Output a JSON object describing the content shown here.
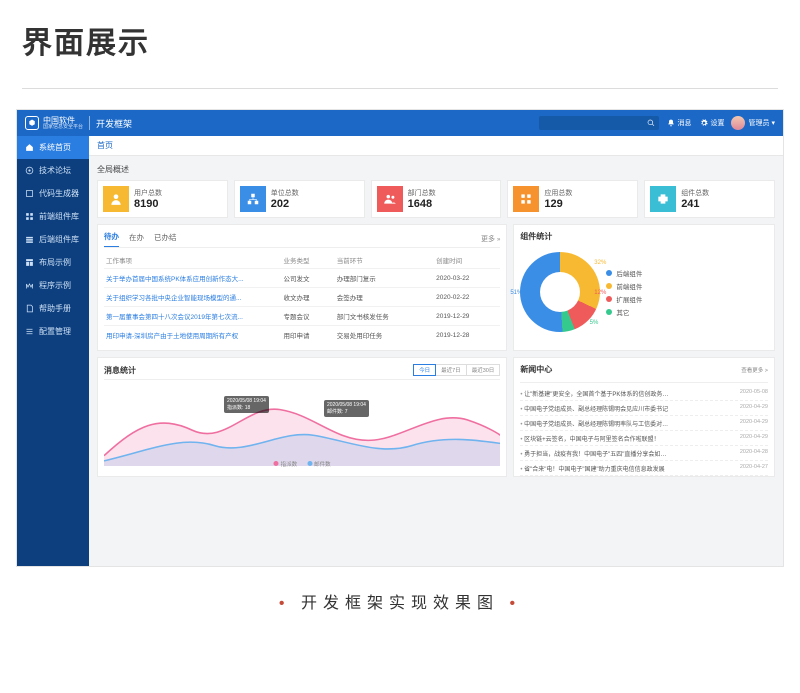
{
  "page": {
    "heading": "界面展示",
    "caption": "开发框架实现效果图"
  },
  "header": {
    "brand": "中国软件",
    "brand_sub": "国家信息安全平台",
    "app": "开发框架",
    "link_msg": "消息",
    "link_set": "设置",
    "role": "管理员"
  },
  "sidebar": {
    "items": [
      {
        "label": "系统首页"
      },
      {
        "label": "技术论坛"
      },
      {
        "label": "代码生成器"
      },
      {
        "label": "前端组件库"
      },
      {
        "label": "后端组件库"
      },
      {
        "label": "布局示例"
      },
      {
        "label": "程序示例"
      },
      {
        "label": "帮助手册"
      },
      {
        "label": "配置管理"
      }
    ]
  },
  "tabbar": {
    "home": "首页"
  },
  "overview": {
    "title": "全局概述",
    "stats": [
      {
        "label": "用户总数",
        "value": "8190"
      },
      {
        "label": "单位总数",
        "value": "202"
      },
      {
        "label": "部门总数",
        "value": "1648"
      },
      {
        "label": "应用总数",
        "value": "129"
      },
      {
        "label": "组件总数",
        "value": "241"
      }
    ]
  },
  "todo": {
    "tabs": [
      "待办",
      "在办",
      "已办结"
    ],
    "more": "更多",
    "cols": [
      "工作事项",
      "业务类型",
      "当前环节",
      "创建时间"
    ],
    "rows": [
      {
        "a": "关于举办首届中国系统PK体系应用创新作态大...",
        "b": "公司发文",
        "c": "办理部门复示",
        "d": "2020-03-22"
      },
      {
        "a": "关于组织学习各批中央企业智能现场模型的通...",
        "b": "收文办理",
        "c": "会签办理",
        "d": "2020-02-22"
      },
      {
        "a": "第一届董事会第四十八次会议2019年第七次流...",
        "b": "专题会议",
        "c": "部门文书核发任务",
        "d": "2019-12-29"
      },
      {
        "a": "用印申请-深圳房产由于土地使用周期所有产权",
        "b": "用印申请",
        "c": "交易处用印任务",
        "d": "2019-12-28"
      }
    ]
  },
  "component_chart": {
    "title": "组件统计",
    "legend": [
      "后端组件",
      "前端组件",
      "扩展组件",
      "其它"
    ],
    "labels": [
      "32%",
      "12%",
      "5%",
      "51%"
    ]
  },
  "msg_chart": {
    "title": "消息统计",
    "ranges": [
      "今日",
      "最近7日",
      "最近30日"
    ],
    "tooltip1_a": "2020/05/08 19:04",
    "tooltip1_b": "指派数: 18",
    "tooltip2_a": "2020/05/08 19:04",
    "tooltip2_b": "邮件数: 7",
    "legend": [
      "指派数",
      "邮件数"
    ]
  },
  "news": {
    "title": "新闻中心",
    "more": "查看更多 >",
    "items": [
      {
        "t": "让\"新基建\"更安全，全国首个基于PK体系的信创政务服务大...",
        "d": "2020-05-08"
      },
      {
        "t": "中国电子党组成员、副总经理陈锡明会见应川市委书记",
        "d": "2020-04-29"
      },
      {
        "t": "中国电子党组成员、副总经理陈锡明率队与工信委对接座谈会",
        "d": "2020-04-29"
      },
      {
        "t": "区块链+云签名，中国电子与阿里签名合作啦联盟！",
        "d": "2020-04-29"
      },
      {
        "t": "勇于担当，战疫有我！中国电子\"五四\"直播分享会如约而至",
        "d": "2020-04-28"
      },
      {
        "t": "省\"合来\"电！中国电子\"国建\"助力重庆电信信息政发展",
        "d": "2020-04-27"
      }
    ]
  },
  "chart_data": {
    "type": "pie",
    "title": "组件统计",
    "series": [
      {
        "name": "后端组件",
        "value": 51
      },
      {
        "name": "前端组件",
        "value": 32
      },
      {
        "name": "扩展组件",
        "value": 12
      },
      {
        "name": "其它",
        "value": 5
      }
    ]
  }
}
